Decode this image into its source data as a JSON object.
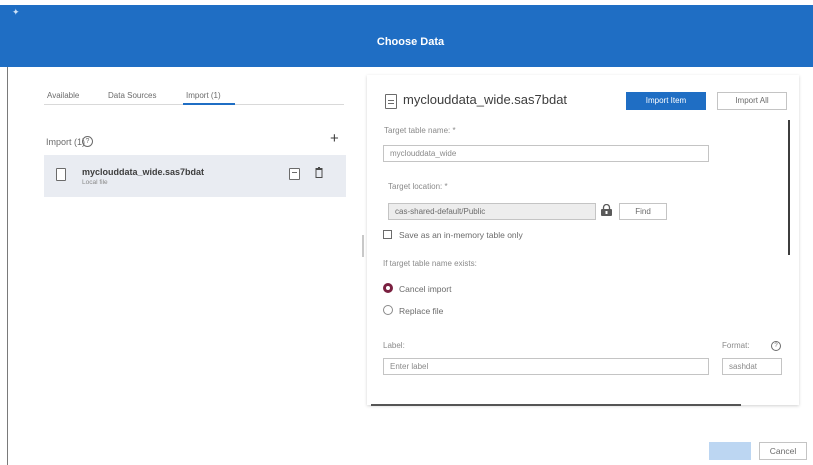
{
  "dialog": {
    "title": "Choose Data"
  },
  "tabs": [
    {
      "label": "Available"
    },
    {
      "label": "Data Sources"
    },
    {
      "label": "Import (1)"
    }
  ],
  "import_panel": {
    "header": "Import (1)",
    "file": {
      "name": "myclouddata_wide.sas7bdat",
      "source": "Local file"
    }
  },
  "details": {
    "title": "myclouddata_wide.sas7bdat",
    "import_item_label": "Import Item",
    "import_all_label": "Import All",
    "target_table_label": "Target table name: *",
    "target_table_value": "myclouddata_wide",
    "target_location_label": "Target location: *",
    "target_location_value": "cas-shared-default/Public",
    "find_label": "Find",
    "in_memory_label": "Save as an in-memory table only",
    "exists_label": "If target table name exists:",
    "options": [
      {
        "label": "Cancel import",
        "selected": true
      },
      {
        "label": "Replace file",
        "selected": false
      }
    ],
    "label_field_label": "Label:",
    "label_placeholder": "Enter label",
    "format_label": "Format:",
    "format_value": "sashdat"
  },
  "footer": {
    "cancel_label": "Cancel"
  },
  "colors": {
    "accent": "#1f6ec4",
    "selected_radio": "#7a2040",
    "row_highlight": "#e9ecf2"
  }
}
